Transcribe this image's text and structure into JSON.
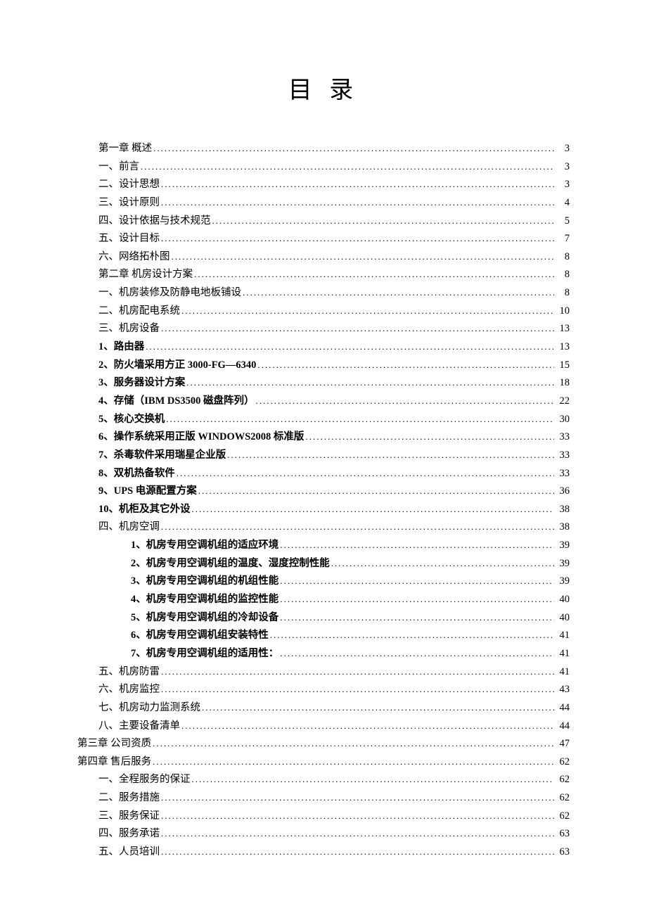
{
  "title": "目 录",
  "entries": [
    {
      "label": "第一章 概述",
      "page": "3",
      "indent": 1,
      "bold": false
    },
    {
      "label": "一、前言",
      "page": "3",
      "indent": 1,
      "bold": false
    },
    {
      "label": "二、设计思想",
      "page": "3",
      "indent": 1,
      "bold": false
    },
    {
      "label": "三、设计原则",
      "page": "4",
      "indent": 1,
      "bold": false
    },
    {
      "label": "四、设计依据与技术规范",
      "page": "5",
      "indent": 1,
      "bold": false
    },
    {
      "label": "五、设计目标",
      "page": "7",
      "indent": 1,
      "bold": false
    },
    {
      "label": "六、网络拓朴图",
      "page": "8",
      "indent": 1,
      "bold": false
    },
    {
      "label": "第二章 机房设计方案",
      "page": "8",
      "indent": 1,
      "bold": false
    },
    {
      "label": "一、机房装修及防静电地板铺设",
      "page": "8",
      "indent": 1,
      "bold": false
    },
    {
      "label": "二、机房配电系统",
      "page": "10",
      "indent": 1,
      "bold": false
    },
    {
      "label": "三、机房设备",
      "page": "13",
      "indent": 1,
      "bold": false
    },
    {
      "label": "1、路由器",
      "page": "13",
      "indent": 1,
      "bold": true
    },
    {
      "label": "2、防火墙采用方正 3000-FG—6340",
      "page": "15",
      "indent": 1,
      "bold": true
    },
    {
      "label": "3、服务器设计方案",
      "page": "18",
      "indent": 1,
      "bold": true
    },
    {
      "label": "4、存储（IBM DS3500 磁盘阵列）",
      "page": "22",
      "indent": 1,
      "bold": true
    },
    {
      "label": "5、核心交换机",
      "page": "30",
      "indent": 1,
      "bold": true
    },
    {
      "label": "6、操作系统采用正版 WINDOWS2008 标准版",
      "page": "33",
      "indent": 1,
      "bold": true
    },
    {
      "label": "7、杀毒软件采用瑞星企业版",
      "page": "33",
      "indent": 1,
      "bold": true
    },
    {
      "label": "8、双机热备软件",
      "page": "33",
      "indent": 1,
      "bold": true
    },
    {
      "label": "9、UPS 电源配置方案",
      "page": "36",
      "indent": 1,
      "bold": true
    },
    {
      "label": "10、机柜及其它外设",
      "page": "38",
      "indent": 1,
      "bold": true
    },
    {
      "label": "四、机房空调",
      "page": "38",
      "indent": 1,
      "bold": false
    },
    {
      "label": "1、机房专用空调机组的适应环境",
      "page": "39",
      "indent": 2,
      "bold": true
    },
    {
      "label": "2、机房专用空调机组的温度、湿度控制性能",
      "page": "39",
      "indent": 2,
      "bold": true
    },
    {
      "label": "3、机房专用空调机组的机组性能",
      "page": "39",
      "indent": 2,
      "bold": true
    },
    {
      "label": "4、机房专用空调机组的监控性能",
      "page": "40",
      "indent": 2,
      "bold": true
    },
    {
      "label": "5、机房专用空调机组的冷却设备",
      "page": "40",
      "indent": 2,
      "bold": true
    },
    {
      "label": "6、机房专用空调机组安装特性",
      "page": "41",
      "indent": 2,
      "bold": true
    },
    {
      "label": "7、机房专用空调机组的适用性：",
      "page": "41",
      "indent": 2,
      "bold": true
    },
    {
      "label": "五、机房防雷",
      "page": "41",
      "indent": 1,
      "bold": false
    },
    {
      "label": "六、机房监控",
      "page": "43",
      "indent": 1,
      "bold": false
    },
    {
      "label": "七、机房动力监测系统",
      "page": "44",
      "indent": 1,
      "bold": false
    },
    {
      "label": "八、主要设备清单",
      "page": "44",
      "indent": 1,
      "bold": false
    },
    {
      "label": "第三章 公司资质",
      "page": "47",
      "indent": 0,
      "bold": false
    },
    {
      "label": "第四章 售后服务",
      "page": "62",
      "indent": 0,
      "bold": false
    },
    {
      "label": "一、全程服务的保证",
      "page": "62",
      "indent": 1,
      "bold": false
    },
    {
      "label": "二、服务措施",
      "page": "62",
      "indent": 1,
      "bold": false
    },
    {
      "label": "三、服务保证",
      "page": "62",
      "indent": 1,
      "bold": false
    },
    {
      "label": "四、服务承诺",
      "page": "63",
      "indent": 1,
      "bold": false
    },
    {
      "label": "五、人员培训",
      "page": "63",
      "indent": 1,
      "bold": false
    }
  ]
}
